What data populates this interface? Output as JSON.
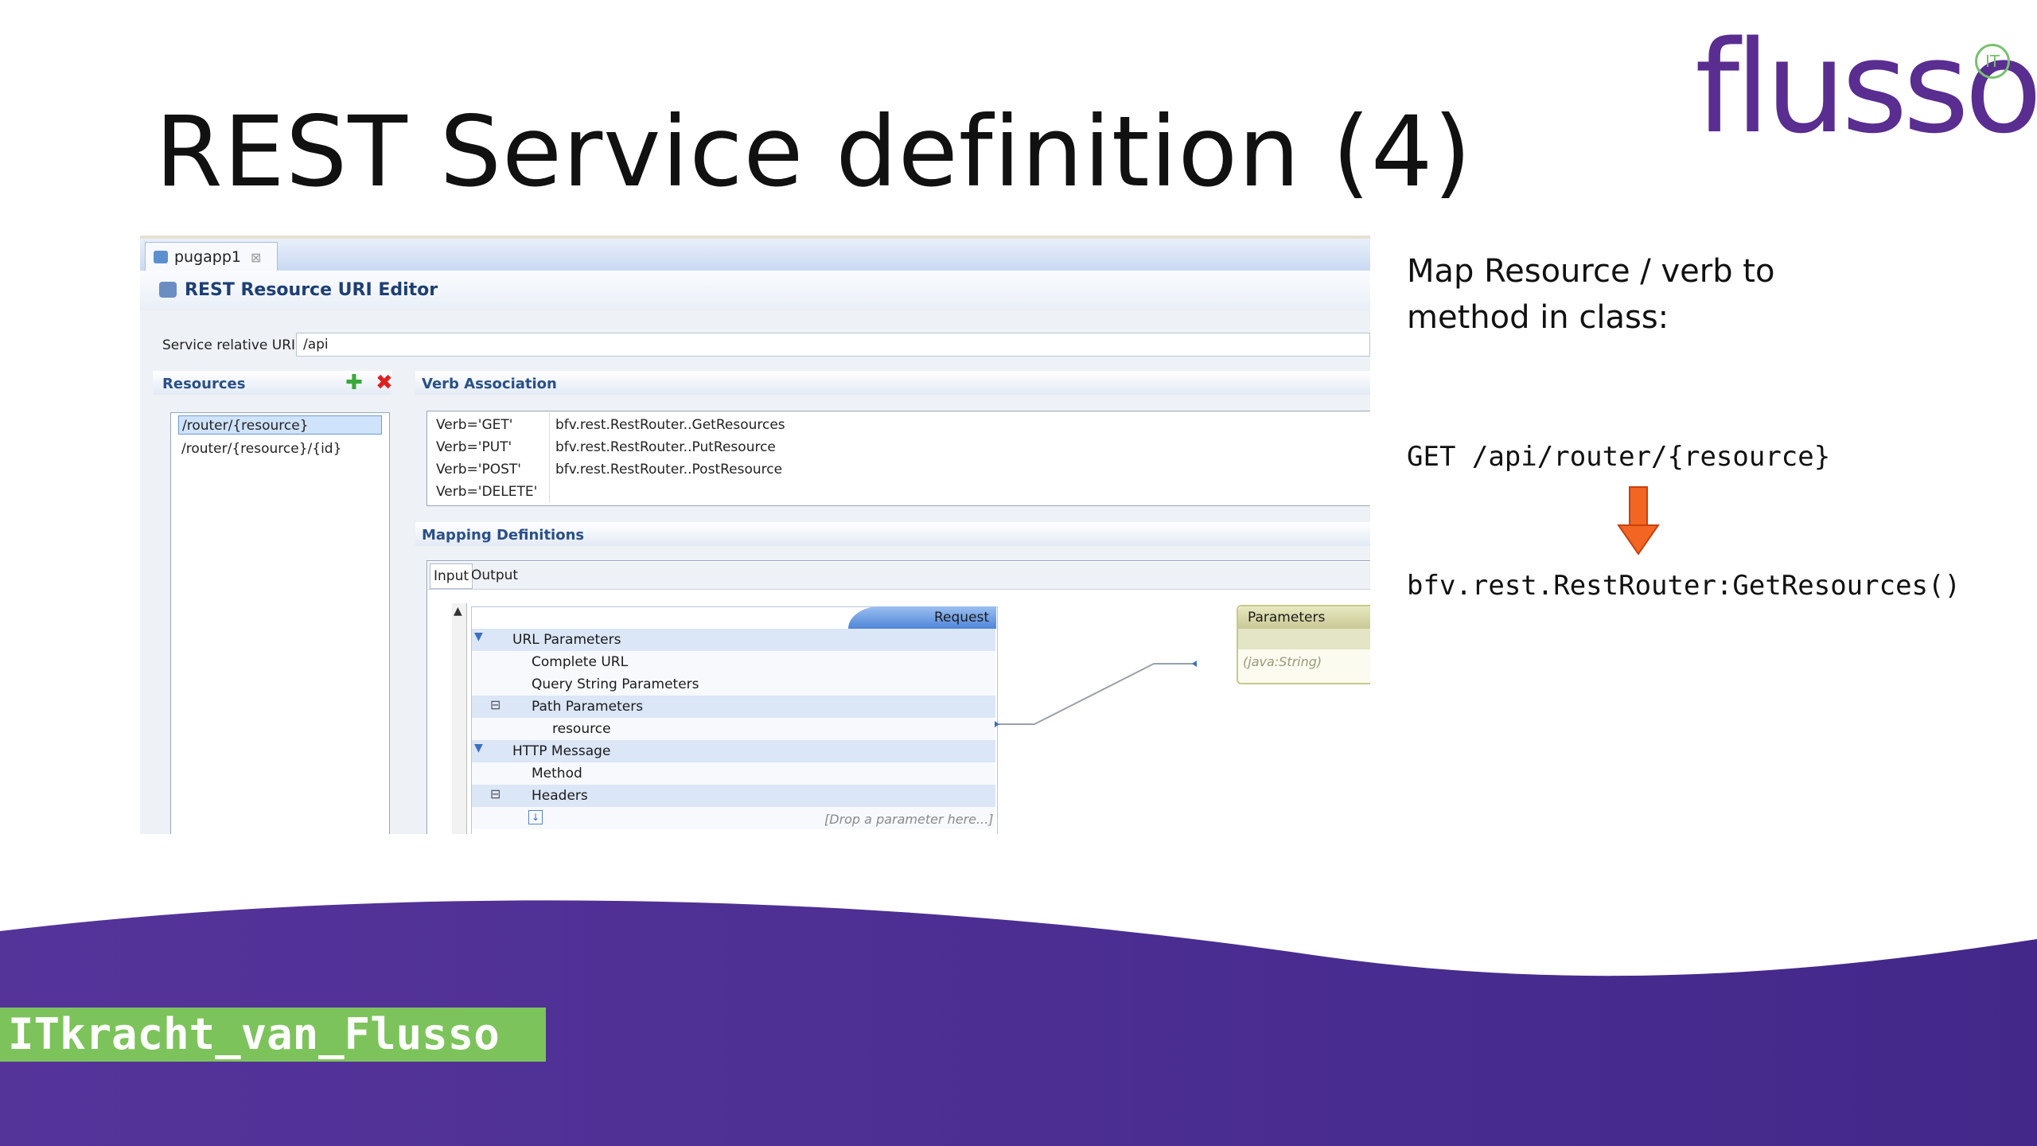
{
  "slide": {
    "title": "REST Service definition (4)",
    "logo_text": "flusso",
    "logo_badge": "IT",
    "hashtag": "ITkracht_van_Flusso"
  },
  "editor": {
    "tab_label": "pugapp1",
    "title": "REST Resource URI Editor",
    "service_uri_label": "Service relative URI:",
    "service_uri_value": "/api",
    "resources_label": "Resources",
    "resources": [
      "/router/{resource}",
      "/router/{resource}/{id}"
    ],
    "verb_association_label": "Verb Association",
    "verbs": [
      {
        "verb": "Verb='GET'",
        "method": "bfv.rest.RestRouter..GetResources"
      },
      {
        "verb": "Verb='PUT'",
        "method": "bfv.rest.RestRouter..PutResource"
      },
      {
        "verb": "Verb='POST'",
        "method": "bfv.rest.RestRouter..PostResource"
      },
      {
        "verb": "Verb='DELETE'",
        "method": ""
      }
    ],
    "mapping_label": "Mapping Definitions",
    "mapping_tabs": [
      "Input",
      "Output"
    ],
    "request_label": "Request",
    "tree": [
      "URL Parameters",
      "Complete URL",
      "Query String Parameters",
      "Path Parameters",
      "resource",
      "HTTP Message",
      "Method",
      "Headers"
    ],
    "drop_hint": "[Drop a parameter here...]",
    "parameters_label": "Parameters",
    "param_type": "(java:String)"
  },
  "right": {
    "desc_line1": "Map Resource / verb to",
    "desc_line2": "method in class:",
    "request_line": "GET /api/router/{resource}",
    "method_line": "bfv.rest.RestRouter:GetResources()"
  },
  "colors": {
    "brand_purple": "#5a2d91",
    "footer_purple": "#4b2f8f",
    "hashtag_green": "#7dc35b",
    "arrow_orange": "#f05a1e"
  }
}
